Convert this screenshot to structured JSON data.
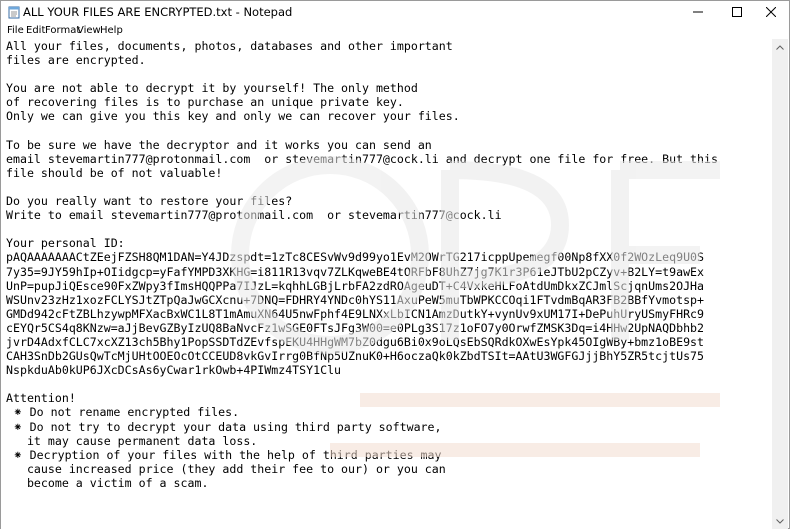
{
  "window": {
    "title": "ALL YOUR FILES ARE ENCRYPTED.txt - Notepad"
  },
  "menu": [
    "File",
    "Edit",
    "Format",
    "View",
    "Help"
  ],
  "document": {
    "lines": [
      "All your files, documents, photos, databases and other important",
      "files are encrypted.",
      "",
      "You are not able to decrypt it by yourself! The only method",
      "of recovering files is to purchase an unique private key.",
      "Only we can give you this key and only we can recover your files.",
      "",
      "To be sure we have the decryptor and it works you can send an",
      "email stevemartin777@protonmail.com  or stevemartin777@cock.li and decrypt one file for free. But this",
      "file should be of not valuable!",
      "",
      "Do you really want to restore your files?",
      "Write to email stevemartin777@protonmail.com  or stevemartin777@cock.li",
      "",
      "Your personal ID:",
      "pAQAAAAAAACtZEejFZSH8QM1DAN=Y4JDzspdt=1zTc8CESvWv9d99yo1EvM2OWrTG217icppUpemegf00Np8fXX0f2WOzLeq9U0S",
      "7y35=9JY59hIp+OIidgcp=yFafYMPD3XKHG=i811R13vqv7ZLKqweBE4tORFbF8UhZ7jg7K1r3P61eJTbU2pCZyv+B2LY=t9awEx",
      "UnP=pupJiQEsce90FxZWpy3fImsHQQPPa7IJzL=kqhhLGBjLrbFA2zdROAgeuDT+C4VxkeHLFoAtdUmDkxZCJmlScjqnUms2OJHa",
      "WSUnv23zHz1xozFCLYSJtZTpQaJwGCXcnu+7DNQ=FDHRY4YNDc0hYS11AxuPeW5muTbWPKCCOqi1FTvdmBqAR3FB2BBfYvmotsp+",
      "GMDd942cFtZBLhzywpMFXacBxWC1L8T1mAmuXN64U5nwFphf4E9LNXxLbICN1AmzDutkY+vynUv9xUM17I+DePuhUryUSmyFHRc9",
      "cEYQr5CS4q8KNzw=aJjBevGZByIzUQ8BaNvcFz1wSGE0FTsJFg3W00=e0PLg3S17z1oFO7y0OrwfZMSK3Dq=i4HHw2UpNAQDbhb2",
      "jvrD4AdxfCLC7xcXZ13ch5Bhy1PopSSDTdZEvfspEKU4HHgWM7bZ0dgu6Bi0x9oLQsEbSQRdkOXwEsYpk45OIgWBy+bmz1oBE9st",
      "CAH3SnDb2GUsQwTcMjUHtOOEOcOtCCEUD8vkGvIrrg0BfNp5UZnuK0+H6oczaQk0kZbdTSIt=AAtU3WGFGJjjBhY5ZR5tcjtUs75",
      "NspkduAb0kUP6JXcDCsAs6yCwar1rkOwb+4PIWmz4TSY1Clu",
      "",
      "Attention!",
      " ⁕ Do not rename encrypted files.",
      " ⁕ Do not try to decrypt your data using third party software,",
      "   it may cause permanent data loss.",
      " ⁕ Decryption of your files with the help of third parties may",
      "   cause increased price (they add their fee to our) or you can",
      "   become a victim of a scam."
    ]
  }
}
